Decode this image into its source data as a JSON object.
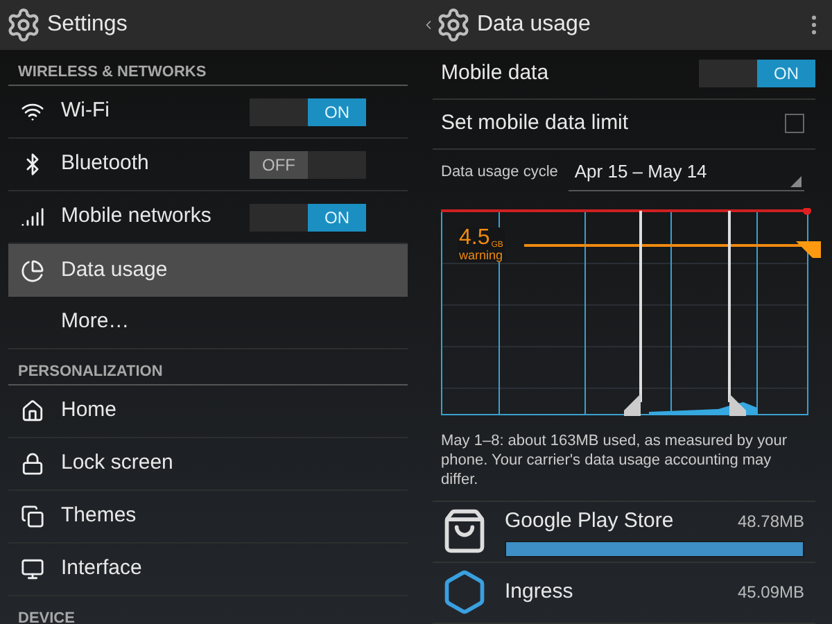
{
  "left_pane": {
    "title": "Settings",
    "sections": [
      {
        "header": "WIRELESS & NETWORKS",
        "items": [
          {
            "kind": "toggle",
            "label": "Wi-Fi",
            "on": true,
            "switch_text": "ON",
            "selected": false
          },
          {
            "kind": "toggle",
            "label": "Bluetooth",
            "on": false,
            "switch_text": "OFF",
            "selected": false
          },
          {
            "kind": "toggle",
            "label": "Mobile networks",
            "on": true,
            "switch_text": "ON",
            "selected": false
          },
          {
            "kind": "plain",
            "label": "Data usage",
            "selected": true
          },
          {
            "kind": "plain",
            "label": "More…",
            "selected": false
          }
        ]
      },
      {
        "header": "PERSONALIZATION",
        "items": [
          {
            "kind": "plain",
            "label": "Home",
            "selected": false
          },
          {
            "kind": "plain",
            "label": "Lock screen",
            "selected": false
          },
          {
            "kind": "plain",
            "label": "Themes",
            "selected": false
          },
          {
            "kind": "plain",
            "label": "Interface",
            "selected": false
          }
        ]
      },
      {
        "header": "DEVICE"
      }
    ]
  },
  "right_pane": {
    "title": "Data usage",
    "mobile_data": {
      "label": "Mobile data",
      "on": true,
      "switch_text": "ON"
    },
    "data_limit": {
      "label": "Set mobile data limit",
      "checked": false
    },
    "cycle": {
      "label": "Data usage cycle",
      "value": "Apr 15 – May 14"
    },
    "warning": {
      "value": "4.5",
      "unit": "GB",
      "label": "warning"
    },
    "note": "May 1–8: about 163MB used, as measured by your phone. Your carrier's data usage accounting may differ.",
    "apps": [
      {
        "name": "Google Play Store",
        "size": "48.78MB",
        "level": 1.0
      },
      {
        "name": "Ingress",
        "size": "45.09MB"
      }
    ]
  }
}
